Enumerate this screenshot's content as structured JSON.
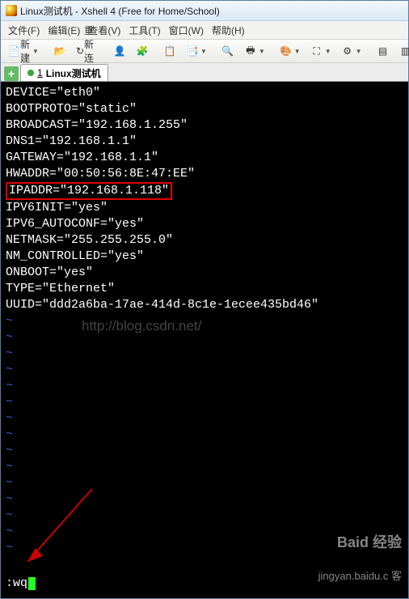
{
  "window": {
    "title": "Linux测试机 - Xshell 4 (Free for Home/School)"
  },
  "menus": {
    "file": "文件(F)",
    "edit": "编辑(E)",
    "view": "查看(V)",
    "tools": "工具(T)",
    "window": "窗口(W)",
    "help": "帮助(H)"
  },
  "toolbar": {
    "new": "新建",
    "reconnect": "重新连接"
  },
  "tab": {
    "index": "1",
    "label": "Linux测试机"
  },
  "config_lines": {
    "device": "DEVICE=\"eth0\"",
    "bootproto": "BOOTPROTO=\"static\"",
    "broadcast": "BROADCAST=\"192.168.1.255\"",
    "dns1": "DNS1=\"192.168.1.1\"",
    "gateway": "GATEWAY=\"192.168.1.1\"",
    "hwaddr": "HWADDR=\"00:50:56:8E:47:EE\"",
    "ipaddr": "IPADDR=\"192.168.1.118\"",
    "ipv6init": "IPV6INIT=\"yes\"",
    "ipv6autoconf": "IPV6_AUTOCONF=\"yes\"",
    "netmask": "NETMASK=\"255.255.255.0\"",
    "nmcontrolled": "NM_CONTROLLED=\"yes\"",
    "onboot": "ONBOOT=\"yes\"",
    "type": "TYPE=\"Ethernet\"",
    "uuid": "UUID=\"ddd2a6ba-17ae-414d-8c1e-1ecee435bd46\""
  },
  "tilde_char": "~",
  "command": ":wq",
  "watermarks": {
    "blog": "http://blog.csdn.net/",
    "brand": "Baid 经验",
    "brandsub": "jingyan.baidu.c 客"
  }
}
